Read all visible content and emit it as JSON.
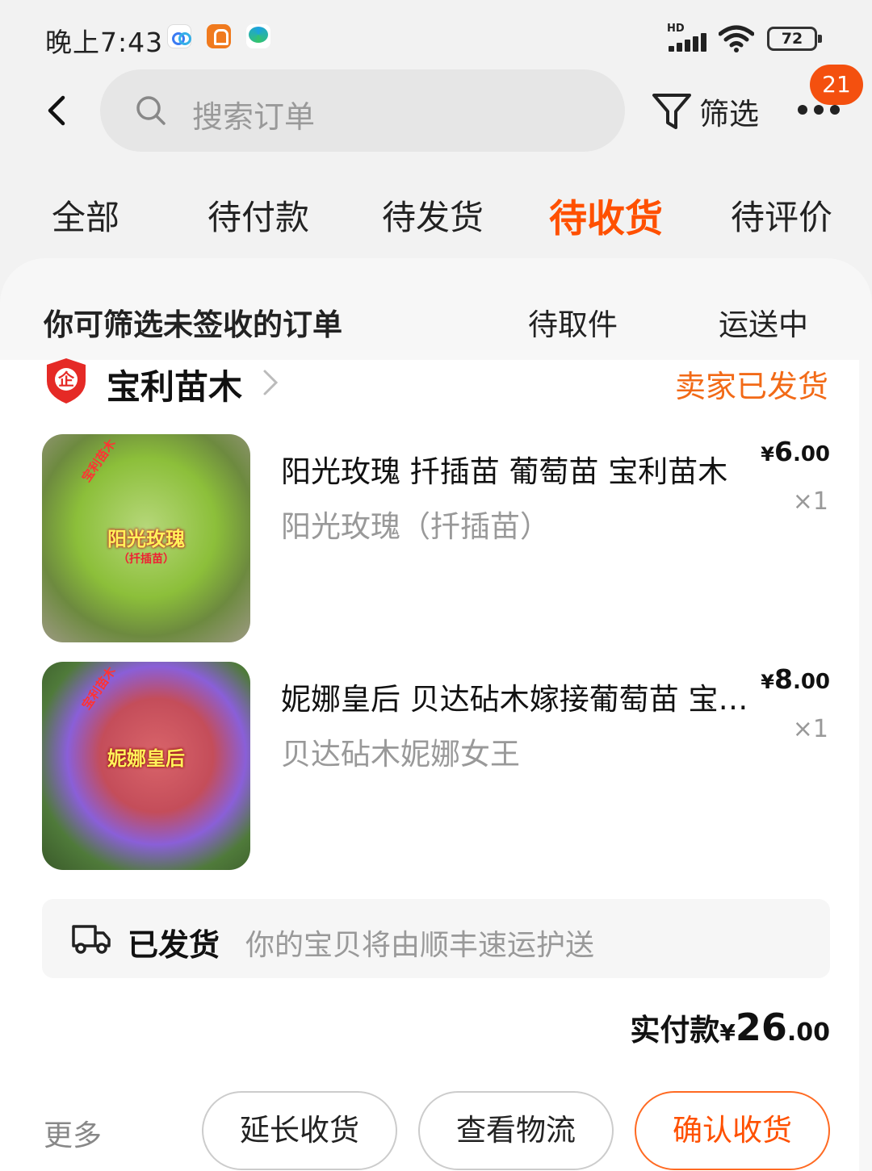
{
  "status_bar": {
    "time": "晚上7:43",
    "network_label": "HD",
    "battery": "72",
    "icons": [
      "baidu-cloud-icon",
      "orange-app-icon",
      "china-mobile-icon",
      "signal-icon",
      "wifi-icon",
      "battery-icon"
    ]
  },
  "header": {
    "search_placeholder": "搜索订单",
    "filter_label": "筛选",
    "notification_count": "21"
  },
  "tabs": [
    {
      "label": "全部",
      "active": false
    },
    {
      "label": "待付款",
      "active": false
    },
    {
      "label": "待发货",
      "active": false
    },
    {
      "label": "待收货",
      "active": true
    },
    {
      "label": "待评价",
      "active": false
    }
  ],
  "sub_filter": {
    "title": "你可筛选未签收的订单",
    "chips": [
      "待取件",
      "运送中"
    ]
  },
  "order": {
    "shop_name": "宝利苗木",
    "status": "卖家已发货",
    "items": [
      {
        "title": "阳光玫瑰 扦插苗 葡萄苗  宝利苗木",
        "sku": "阳光玫瑰（扦插苗）",
        "price_symbol": "¥",
        "price_int": "6",
        "price_dec": ".00",
        "qty": "×1",
        "image_label": "阳光玫瑰",
        "image_sublabel": "（扦插苗）",
        "image_watermark": "宝利苗木"
      },
      {
        "title": "妮娜皇后  贝达砧木嫁接葡萄苗  宝利苗木",
        "sku": "贝达砧木妮娜女王",
        "price_symbol": "¥",
        "price_int": "8",
        "price_dec": ".00",
        "qty": "×1",
        "image_label": "妮娜皇后",
        "image_watermark": "宝利苗木"
      }
    ],
    "shipping": {
      "label": "已发货",
      "desc": "你的宝贝将由顺丰速运护送"
    },
    "total": {
      "label": "实付款",
      "symbol": "¥",
      "int": "26",
      "dec": ".00"
    },
    "actions": {
      "more": "更多",
      "extend": "延长收货",
      "logistics": "查看物流",
      "confirm": "确认收货"
    }
  },
  "colors": {
    "accent": "#ff5000",
    "status_orange": "#f26a17",
    "badge_red": "#f4500f"
  }
}
